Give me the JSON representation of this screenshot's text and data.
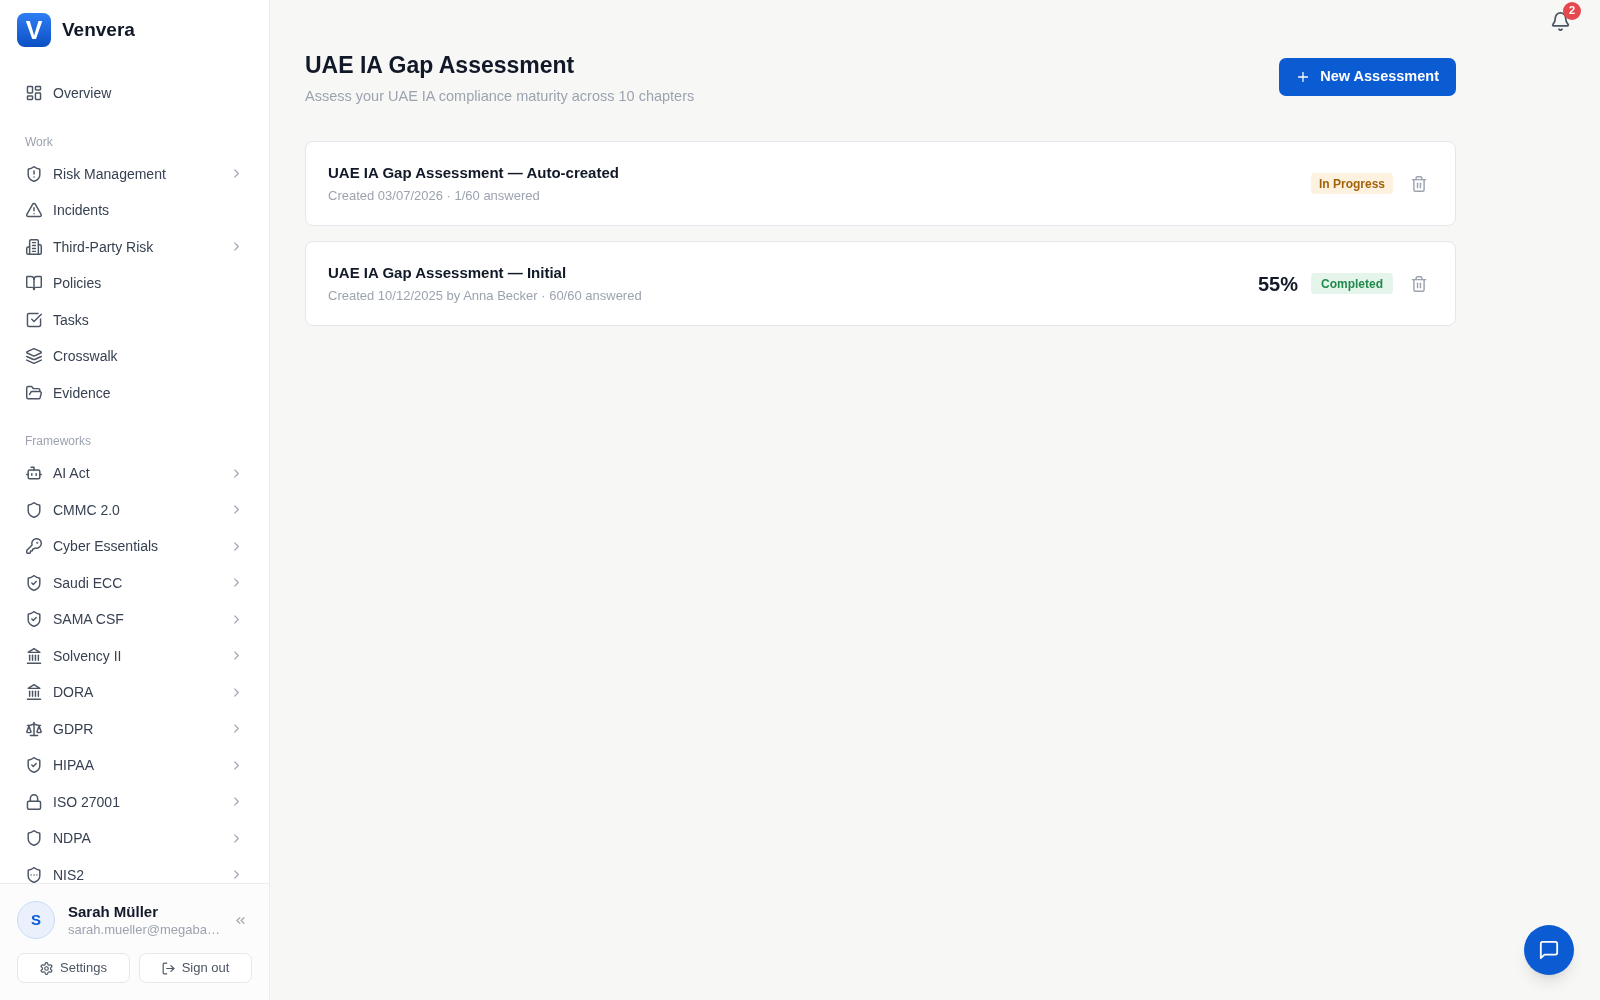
{
  "brand": {
    "logo": "V",
    "name": "Venvera"
  },
  "sidebar": {
    "sections": [
      {
        "items": [
          {
            "label": "Overview",
            "expandable": false
          }
        ]
      },
      {
        "label": "Work",
        "items": [
          {
            "label": "Risk Management",
            "expandable": true
          },
          {
            "label": "Incidents",
            "expandable": false
          },
          {
            "label": "Third-Party Risk",
            "expandable": true
          },
          {
            "label": "Policies",
            "expandable": false
          },
          {
            "label": "Tasks",
            "expandable": false
          },
          {
            "label": "Crosswalk",
            "expandable": false
          },
          {
            "label": "Evidence",
            "expandable": false
          }
        ]
      },
      {
        "label": "Frameworks",
        "items": [
          {
            "label": "AI Act",
            "expandable": true
          },
          {
            "label": "CMMC 2.0",
            "expandable": true
          },
          {
            "label": "Cyber Essentials",
            "expandable": true
          },
          {
            "label": "Saudi ECC",
            "expandable": true
          },
          {
            "label": "SAMA CSF",
            "expandable": true
          },
          {
            "label": "Solvency II",
            "expandable": true
          },
          {
            "label": "DORA",
            "expandable": true
          },
          {
            "label": "GDPR",
            "expandable": true
          },
          {
            "label": "HIPAA",
            "expandable": true
          },
          {
            "label": "ISO 27001",
            "expandable": true
          },
          {
            "label": "NDPA",
            "expandable": true
          },
          {
            "label": "NIS2",
            "expandable": true
          }
        ]
      }
    ]
  },
  "user": {
    "initial": "S",
    "name": "Sarah Müller",
    "email": "sarah.mueller@megaba…"
  },
  "sidebar_buttons": [
    "Settings",
    "Sign out"
  ],
  "notifications": {
    "count": "2"
  },
  "page": {
    "title": "UAE IA Gap Assessment",
    "subtitle": "Assess your UAE IA compliance maturity across 10 chapters",
    "action": "New Assessment"
  },
  "assessments": [
    {
      "title": "UAE IA Gap Assessment — Auto-created",
      "meta": "Created 03/07/2026 · 1/60 answered",
      "status": {
        "kind": "in_progress",
        "label": "In Progress"
      }
    },
    {
      "title": "UAE IA Gap Assessment — Initial",
      "meta": "Created 10/12/2025 by Anna Becker · 60/60 answered",
      "score": "55%",
      "status": {
        "kind": "completed",
        "label": "Completed"
      }
    }
  ]
}
